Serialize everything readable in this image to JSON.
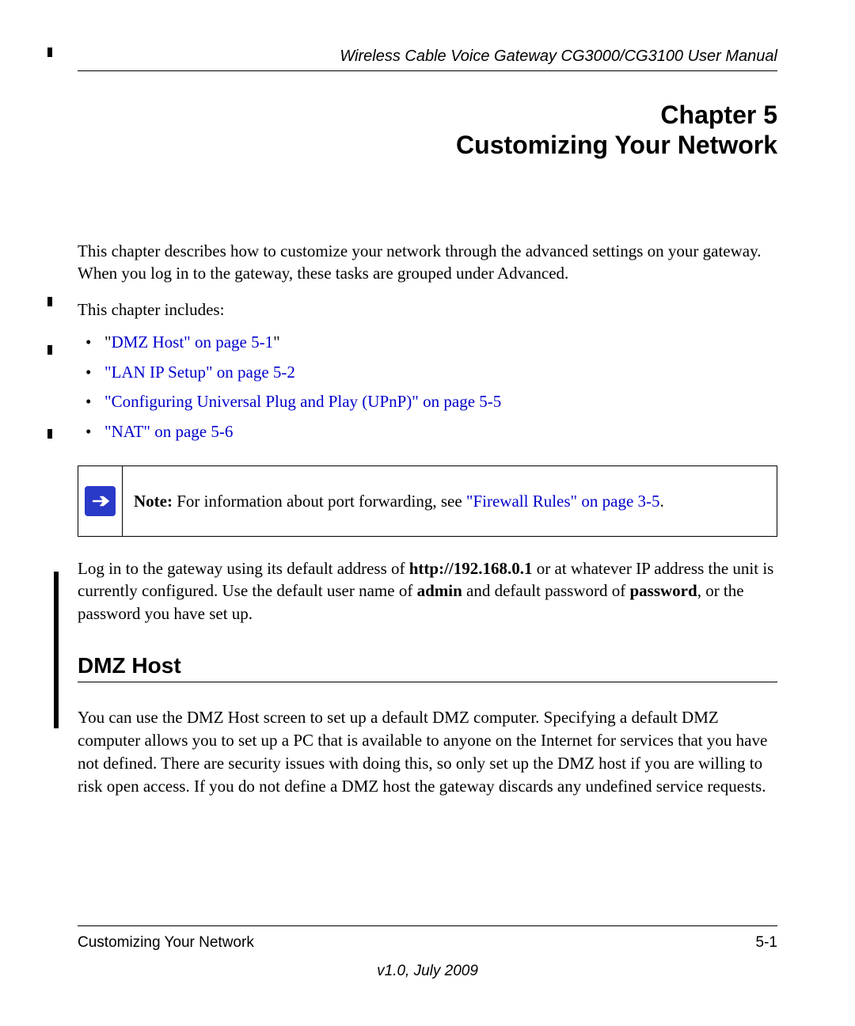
{
  "header": {
    "title": "Wireless Cable Voice Gateway CG3000/CG3100 User Manual"
  },
  "chapter": {
    "line1": "Chapter 5",
    "line2": "Customizing Your Network"
  },
  "intro": "This chapter describes how to customize your network through the advanced settings on your gateway. When you log in to the gateway, these tasks are grouped under Advanced.",
  "includes_label": "This chapter includes:",
  "toc": {
    "items": [
      {
        "prefix": "\"",
        "link": "DMZ Host\" on page 5-1",
        "suffix": "\""
      },
      {
        "prefix": "",
        "link": "\"LAN IP Setup\" on page 5-2",
        "suffix": ""
      },
      {
        "prefix": "",
        "link": "\"Configuring Universal Plug and Play (UPnP)\" on page 5-5",
        "suffix": ""
      },
      {
        "prefix": "",
        "link": "\"NAT\" on page 5-6",
        "suffix": ""
      }
    ]
  },
  "note": {
    "label": "Note:",
    "text": " For information about port forwarding, see ",
    "link": "\"Firewall Rules\" on page 3-5",
    "suffix": "."
  },
  "login": {
    "p1a": "Log in to the gateway using its default address of ",
    "p1b": "http://192.168.0.1",
    "p1c": " or at whatever IP address the unit is currently configured. Use the default user name of ",
    "p1d": "admin",
    "p1e": " and default password of ",
    "p1f": "password",
    "p1g": ", or the password you have set up."
  },
  "section": {
    "heading": "DMZ Host",
    "body": "You can use the DMZ Host screen to set up a default DMZ computer. Specifying a default DMZ computer allows you to set up a PC that is available to anyone on the Internet for services that you have not defined. There are security issues with doing this, so only set up the DMZ host if you are willing to risk open access. If you do not define a DMZ host the gateway discards any undefined service requests."
  },
  "footer": {
    "left": "Customizing Your Network",
    "right": "5-1",
    "version": "v1.0, July 2009"
  }
}
